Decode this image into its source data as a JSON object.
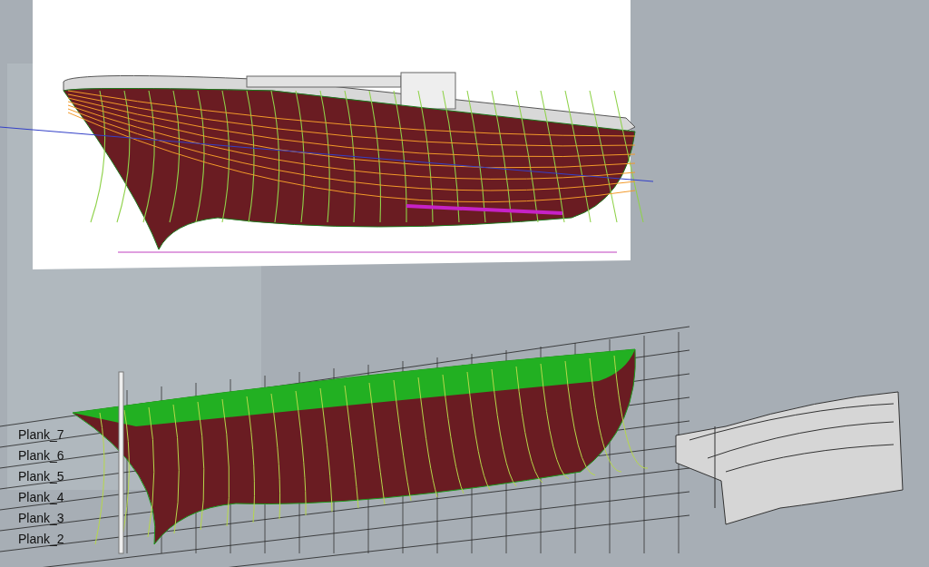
{
  "viewport": {
    "plank_labels": [
      "Plank_7",
      "Plank_6",
      "Plank_5",
      "Plank_4",
      "Plank_3",
      "Plank_2"
    ]
  }
}
